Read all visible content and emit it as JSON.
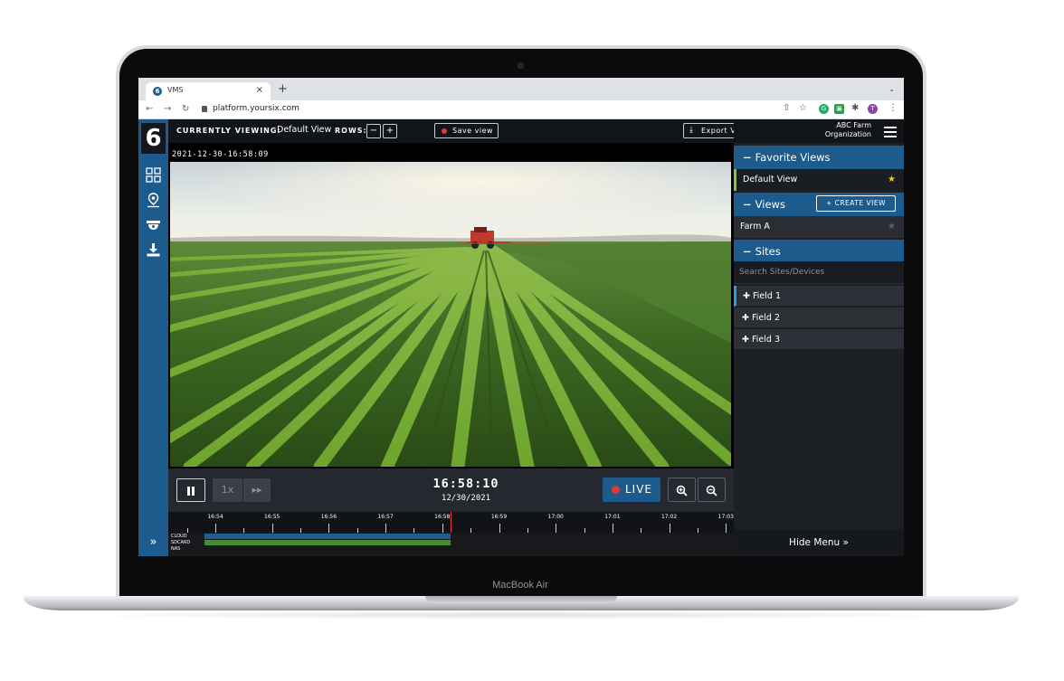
{
  "device": {
    "label": "MacBook Air"
  },
  "browser": {
    "tab_title": "VMS",
    "tab_close": "×",
    "new_tab": "+",
    "url": "platform.yoursix.com",
    "profile_initial": "T"
  },
  "app": {
    "logo": "6",
    "topbar": {
      "currently_viewing_label": "CURRENTLY VIEWING:",
      "view_name": "Default View",
      "rows_label": "ROWS:",
      "rows_minus": "−",
      "rows_plus": "+",
      "save_view": "Save view",
      "export_video": "Export Video"
    },
    "camera": {
      "timestamp": "2021-12-30-16:58:09"
    },
    "controls": {
      "pause_icon": "pause-icon",
      "speed": "1x",
      "time": "16:58:10",
      "date": "12/30/2021",
      "live": "LIVE"
    },
    "timeline": {
      "ticks": [
        "16:54",
        "16:55",
        "16:56",
        "16:57",
        "16:58",
        "16:59",
        "17:00",
        "17:01",
        "17:02",
        "17:03"
      ],
      "tracks": [
        "CLOUD",
        "SDCARD",
        "NAS"
      ]
    },
    "sidebar": {
      "org_name": "ABC Farm",
      "org_type": "Organization",
      "favorite_views_header": "Favorite Views",
      "favorite_views": [
        {
          "label": "Default View"
        }
      ],
      "views_header": "Views",
      "create_view": "+ CREATE VIEW",
      "views": [
        {
          "label": "Farm A"
        }
      ],
      "sites_header": "Sites",
      "search_placeholder": "Search Sites/Devices",
      "sites": [
        {
          "label": "Field 1"
        },
        {
          "label": "Field 2"
        },
        {
          "label": "Field 3"
        }
      ],
      "hide_menu": "Hide Menu"
    },
    "colors": {
      "accent_blue": "#1c5b8c",
      "live_red": "#e53935",
      "favorite_star": "#f5c518",
      "cloud_track": "#1f5f8b",
      "sdcard_track": "#3f8f2f"
    }
  }
}
